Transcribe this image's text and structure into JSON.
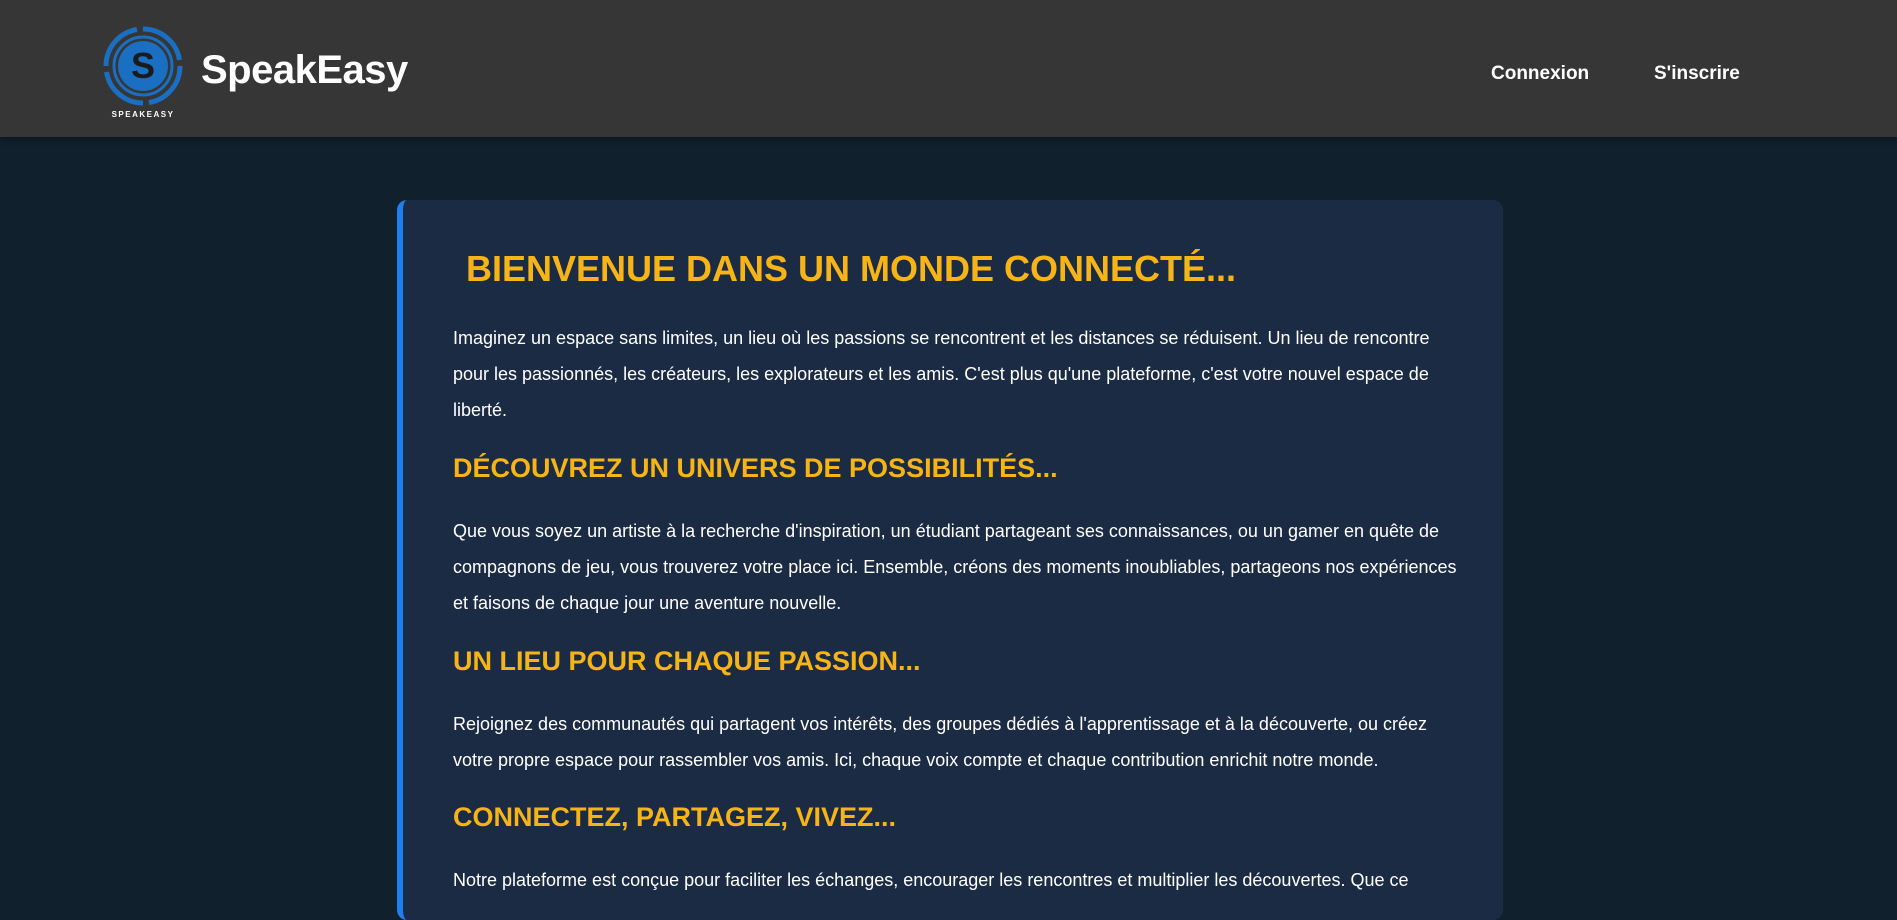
{
  "header": {
    "logo_caption": "SPEAKEASY",
    "logo_letter": "S",
    "brand_name": "SpeakEasy",
    "nav": {
      "login_label": "Connexion",
      "signup_label": "S'inscrire"
    }
  },
  "main": {
    "title": "BIENVENUE DANS UN MONDE CONNECTÉ...",
    "sections": [
      {
        "heading": "",
        "text": "Imaginez un espace sans limites, un lieu où les passions se rencontrent et les distances se réduisent. Un lieu de rencontre pour les passionnés, les créateurs, les explorateurs et les amis. C'est plus qu'une plateforme, c'est votre nouvel espace de liberté."
      },
      {
        "heading": "DÉCOUVREZ UN UNIVERS DE POSSIBILITÉS...",
        "text": "Que vous soyez un artiste à la recherche d'inspiration, un étudiant partageant ses connaissances, ou un gamer en quête de compagnons de jeu, vous trouverez votre place ici. Ensemble, créons des moments inoubliables, partageons nos expériences et faisons de chaque jour une aventure nouvelle."
      },
      {
        "heading": "UN LIEU POUR CHAQUE PASSION...",
        "text": "Rejoignez des communautés qui partagent vos intérêts, des groupes dédiés à l'apprentissage et à la découverte, ou créez votre propre espace pour rassembler vos amis. Ici, chaque voix compte et chaque contribution enrichit notre monde."
      },
      {
        "heading": "CONNECTEZ, PARTAGEZ, VIVEZ...",
        "text": "Notre plateforme est conçue pour faciliter les échanges, encourager les rencontres et multiplier les découvertes. Que ce"
      }
    ]
  },
  "colors": {
    "header_bg": "#363636",
    "page_bg": "#10202c",
    "card_bg": "#1b2b43",
    "accent_border": "#1f7ef0",
    "heading": "#f6b417",
    "text": "#ffffff",
    "logo_blue": "#1a6fc2"
  }
}
